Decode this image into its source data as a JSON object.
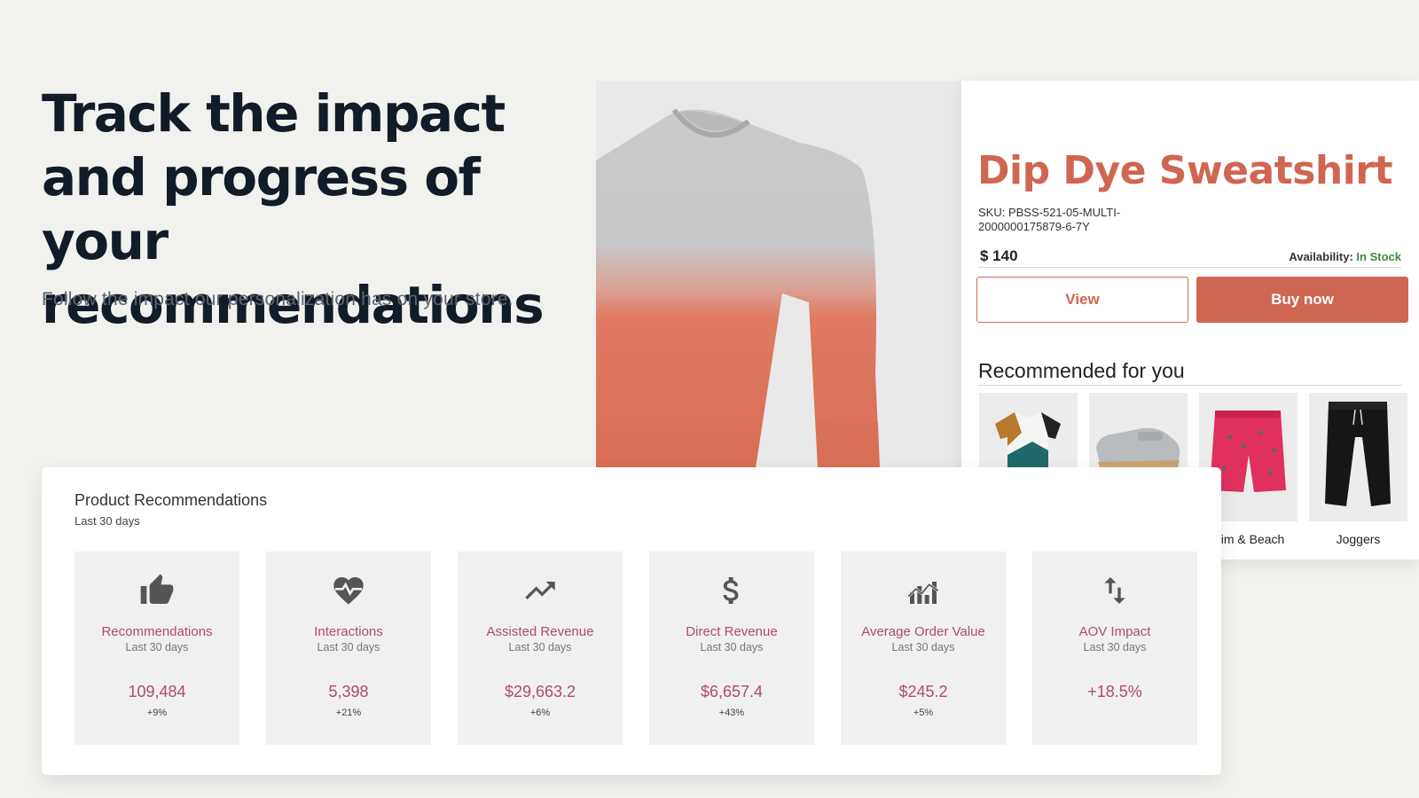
{
  "hero": {
    "title": "Track the impact and progress of your recommendations",
    "subtitle": "Follow the impact our personalization has on your store."
  },
  "product": {
    "name": "Dip Dye Sweatshirt",
    "sku": "SKU: PBSS-521-05-MULTI-2000000175879-6-7Y",
    "price": "$ 140",
    "availability_label": "Availability:",
    "availability_value": "In Stock",
    "view_label": "View",
    "buy_label": "Buy now",
    "brand_color": "#cf6651"
  },
  "recommended": {
    "heading": "Recommended for you",
    "items": [
      {
        "label": "",
        "icon": "tshirt-image"
      },
      {
        "label": "",
        "icon": "shoe-image"
      },
      {
        "label": "wim & Beach",
        "icon": "swim-shorts-image"
      },
      {
        "label": "Joggers",
        "icon": "joggers-image"
      }
    ]
  },
  "stats": {
    "title": "Product Recommendations",
    "range": "Last 30 days",
    "accent_color": "#b04a6f",
    "tiles": [
      {
        "icon": "thumbs-up-icon",
        "label": "Recommendations",
        "period": "Last 30 days",
        "value": "109,484",
        "change": "+9%"
      },
      {
        "icon": "heartbeat-icon",
        "label": "Interactions",
        "period": "Last 30 days",
        "value": "5,398",
        "change": "+21%"
      },
      {
        "icon": "trending-up-icon",
        "label": "Assisted Revenue",
        "period": "Last 30 days",
        "value": "$29,663.2",
        "change": "+6%"
      },
      {
        "icon": "dollar-icon",
        "label": "Direct Revenue",
        "period": "Last 30 days",
        "value": "$6,657.4",
        "change": "+43%"
      },
      {
        "icon": "bar-chart-trend-icon",
        "label": "Average Order Value",
        "period": "Last 30 days",
        "value": "$245.2",
        "change": "+5%"
      },
      {
        "icon": "swap-vertical-icon",
        "label": "AOV Impact",
        "period": "Last 30 days",
        "value": "+18.5%",
        "change": ""
      }
    ]
  }
}
